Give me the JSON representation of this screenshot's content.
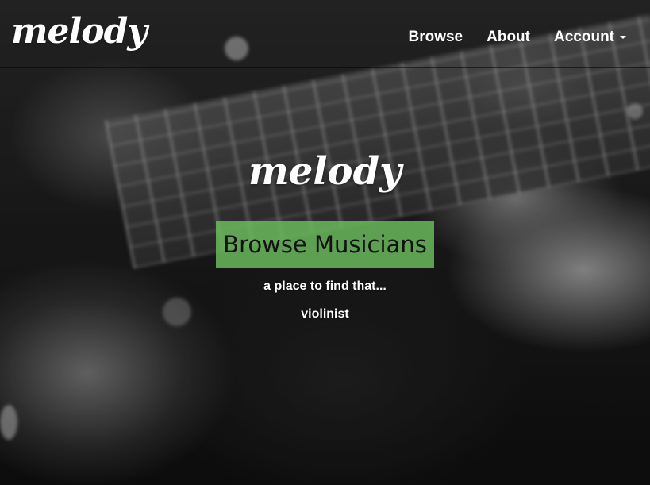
{
  "navbar": {
    "brand": "melody",
    "items": [
      {
        "label": "Browse"
      },
      {
        "label": "About"
      },
      {
        "label": "Account",
        "has_dropdown": true
      }
    ]
  },
  "hero": {
    "title": "melody",
    "cta_label": "Browse Musicians",
    "tagline": "a place to find that...",
    "rotating_word": "violinist",
    "background": "black-and-white photo of hand playing guitar fretboard"
  },
  "colors": {
    "cta_background": "#6ebe5f",
    "text": "#ffffff",
    "cta_text": "#111111"
  }
}
